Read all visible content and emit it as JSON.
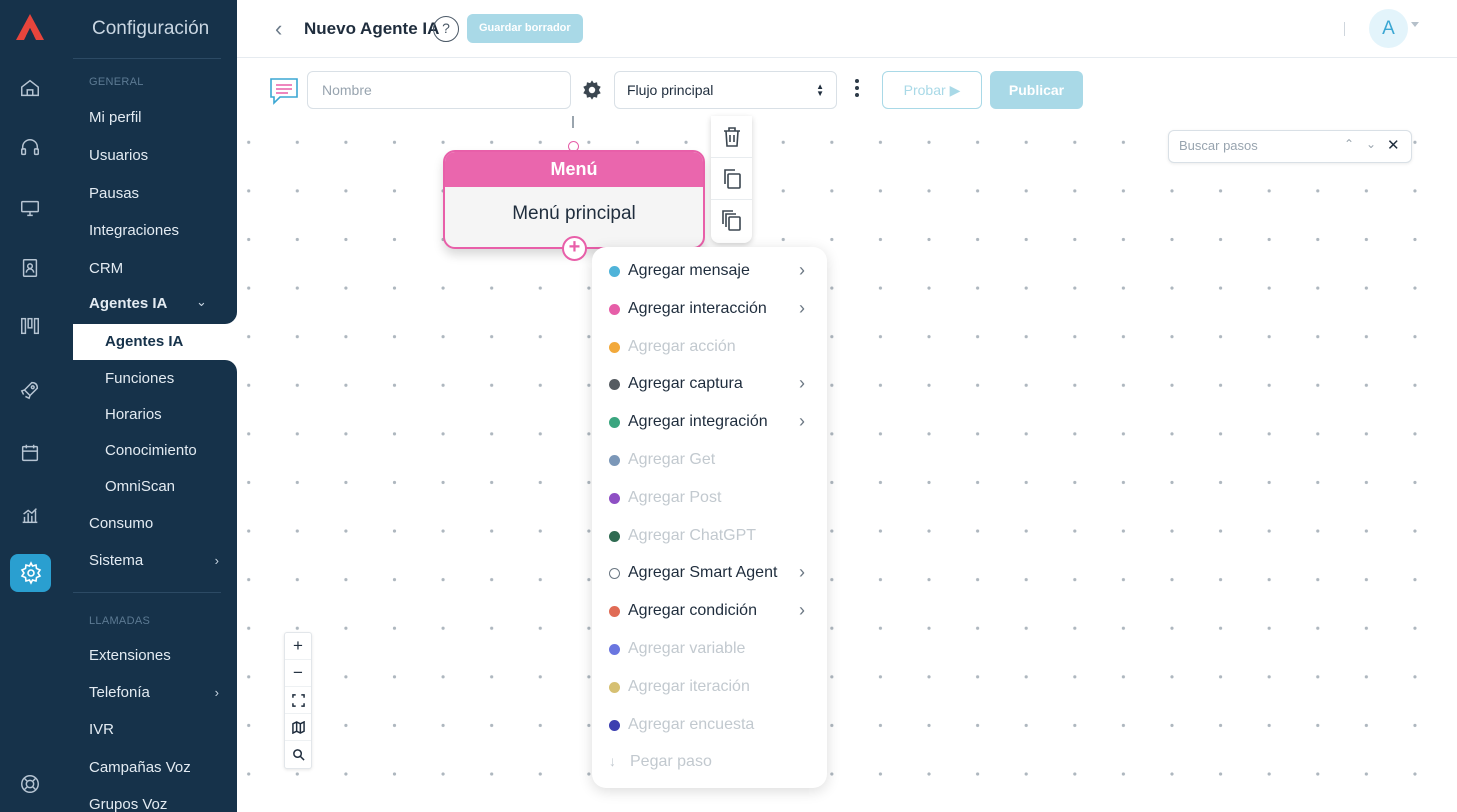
{
  "sidebar": {
    "title": "Configuración",
    "section_general": "GENERAL",
    "section_calls": "LLAMADAS",
    "items": [
      {
        "label": "Mi perfil"
      },
      {
        "label": "Usuarios"
      },
      {
        "label": "Pausas"
      },
      {
        "label": "Integraciones"
      },
      {
        "label": "CRM"
      },
      {
        "label": "Agentes IA"
      },
      {
        "label": "Agentes IA"
      },
      {
        "label": "Funciones"
      },
      {
        "label": "Horarios"
      },
      {
        "label": "Conocimiento"
      },
      {
        "label": "OmniScan"
      },
      {
        "label": "Consumo"
      },
      {
        "label": "Sistema"
      },
      {
        "label": "Extensiones"
      },
      {
        "label": "Telefonía"
      },
      {
        "label": "IVR"
      },
      {
        "label": "Campañas Voz"
      },
      {
        "label": "Grupos Voz"
      }
    ]
  },
  "header": {
    "back_glyph": "‹",
    "title": "Nuevo Agente IA",
    "help_glyph": "?",
    "draft_label": "Guardar borrador",
    "avatar_initial": "A"
  },
  "toolbar": {
    "name_placeholder": "Nombre",
    "flow_selected": "Flujo principal",
    "try_label": "Probar",
    "publish_label": "Publicar"
  },
  "node": {
    "header": "Menú",
    "body": "Menú principal"
  },
  "search_steps": {
    "placeholder": "Buscar pasos"
  },
  "context_menu": {
    "items": [
      {
        "label": "Agregar mensaje",
        "color": "#4fb3d9",
        "enabled": true,
        "submenu": true
      },
      {
        "label": "Agregar interacción",
        "color": "#e65ea8",
        "enabled": true,
        "submenu": true
      },
      {
        "label": "Agregar acción",
        "color": "#f2a93b",
        "enabled": false,
        "submenu": false
      },
      {
        "label": "Agregar captura",
        "color": "#555b61",
        "enabled": true,
        "submenu": true
      },
      {
        "label": "Agregar integración",
        "color": "#3aa57f",
        "enabled": true,
        "submenu": true
      },
      {
        "label": "Agregar Get",
        "color": "#7b97b8",
        "enabled": false,
        "submenu": false
      },
      {
        "label": "Agregar Post",
        "color": "#8e4fc4",
        "enabled": false,
        "submenu": false
      },
      {
        "label": "Agregar ChatGPT",
        "color": "#2f6b52",
        "enabled": false,
        "submenu": false
      },
      {
        "label": "Agregar Smart Agent",
        "color": "#ffffff",
        "enabled": true,
        "submenu": true
      },
      {
        "label": "Agregar condición",
        "color": "#e06b55",
        "enabled": true,
        "submenu": true
      },
      {
        "label": "Agregar variable",
        "color": "#6a76e0",
        "enabled": false,
        "submenu": false
      },
      {
        "label": "Agregar iteración",
        "color": "#d6c072",
        "enabled": false,
        "submenu": false
      },
      {
        "label": "Agregar encuesta",
        "color": "#3c3fb0",
        "enabled": false,
        "submenu": false
      },
      {
        "label": "Pegar paso",
        "color": "",
        "enabled": false,
        "submenu": false
      }
    ]
  },
  "colors": {
    "sidebar_bg": "#16324a",
    "accent": "#2a9fd0",
    "node_pink": "#ea66ad",
    "disabled_button": "#a9d9e7"
  }
}
